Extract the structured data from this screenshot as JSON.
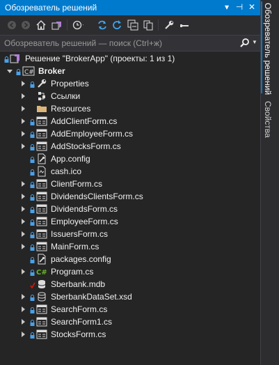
{
  "window": {
    "title": "Обозреватель решений",
    "dropdown_glyph": "▾",
    "pin_glyph": "⊣",
    "close_glyph": "✕"
  },
  "toolbar": {
    "buttons": [
      "back-icon",
      "forward-icon",
      "home-icon",
      "vs-switch-icon",
      "history-icon",
      "sync-icon",
      "refresh-icon",
      "collapse-all-icon",
      "show-all-files-icon",
      "properties-wrench-icon",
      "preview-icon"
    ]
  },
  "search": {
    "placeholder": "Обозреватель решений — поиск (Ctrl+ж)",
    "value": ""
  },
  "tree": {
    "solution": "Решение \"BrokerApp\" (проекты: 1 из 1)",
    "project": "Broker",
    "items": [
      {
        "label": "Properties",
        "icon": "wrench-icon",
        "expandable": true,
        "locked": true
      },
      {
        "label": "Ссылки",
        "icon": "references-icon",
        "expandable": true,
        "locked": false
      },
      {
        "label": "Resources",
        "icon": "folder-icon",
        "expandable": true,
        "locked": false
      },
      {
        "label": "AddClientForm.cs",
        "icon": "form-icon",
        "expandable": true,
        "locked": true
      },
      {
        "label": "AddEmployeeForm.cs",
        "icon": "form-icon",
        "expandable": true,
        "locked": true
      },
      {
        "label": "AddStocksForm.cs",
        "icon": "form-icon",
        "expandable": true,
        "locked": true
      },
      {
        "label": "App.config",
        "icon": "config-icon",
        "expandable": false,
        "locked": true
      },
      {
        "label": "cash.ico",
        "icon": "ico-file-icon",
        "expandable": false,
        "locked": true
      },
      {
        "label": "ClientForm.cs",
        "icon": "form-icon",
        "expandable": true,
        "locked": true
      },
      {
        "label": "DividendsClientsForm.cs",
        "icon": "form-icon",
        "expandable": true,
        "locked": true
      },
      {
        "label": "DividendsForm.cs",
        "icon": "form-icon",
        "expandable": true,
        "locked": true
      },
      {
        "label": "EmployeeForm.cs",
        "icon": "form-icon",
        "expandable": true,
        "locked": true
      },
      {
        "label": "IssuersForm.cs",
        "icon": "form-icon",
        "expandable": true,
        "locked": true
      },
      {
        "label": "MainForm.cs",
        "icon": "form-icon",
        "expandable": true,
        "locked": true
      },
      {
        "label": "packages.config",
        "icon": "config-icon",
        "expandable": false,
        "locked": true
      },
      {
        "label": "Program.cs",
        "icon": "csharp-icon",
        "expandable": true,
        "locked": true
      },
      {
        "label": "Sberbank.mdb",
        "icon": "database-icon",
        "expandable": false,
        "locked": false,
        "checked": true
      },
      {
        "label": "SberbankDataSet.xsd",
        "icon": "dataset-icon",
        "expandable": true,
        "locked": true
      },
      {
        "label": "SearchForm.cs",
        "icon": "form-icon",
        "expandable": true,
        "locked": true
      },
      {
        "label": "SearchForm1.cs",
        "icon": "form-icon",
        "expandable": true,
        "locked": true
      },
      {
        "label": "StocksForm.cs",
        "icon": "form-icon",
        "expandable": true,
        "locked": true
      }
    ]
  },
  "side_tabs": {
    "solution_explorer": "Обозреватель решений",
    "properties": "Свойства"
  },
  "colors": {
    "accent": "#007acc",
    "background": "#252526",
    "text": "#f1f1f1"
  }
}
